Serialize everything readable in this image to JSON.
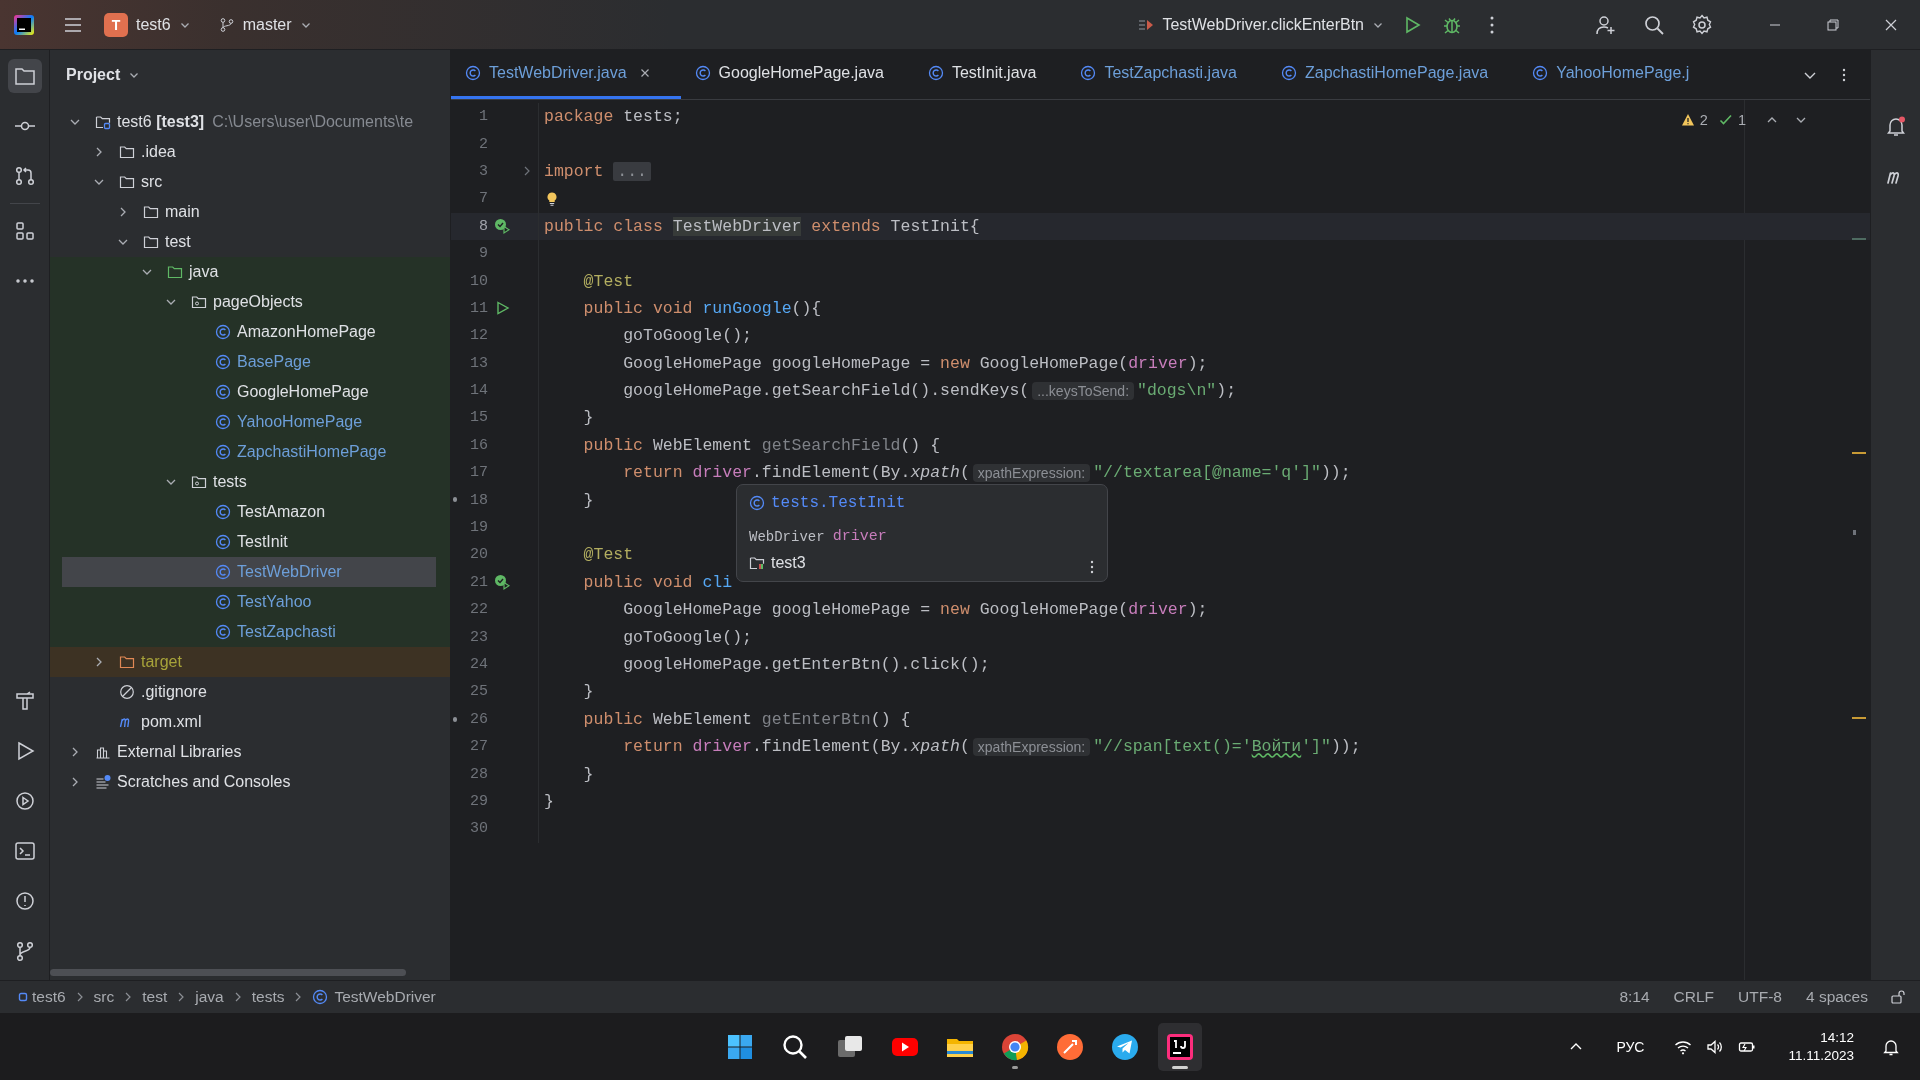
{
  "topbar": {
    "project_badge": "T",
    "project": "test6",
    "branch": "master",
    "run_config": "TestWebDriver.clickEnterBtn"
  },
  "left_toolbar": [
    {
      "kind": "project",
      "selected": true
    },
    {
      "kind": "commit",
      "selected": false
    },
    {
      "kind": "pull-requests",
      "selected": false
    },
    {
      "kind": "structure",
      "selected": false
    },
    {
      "kind": "more",
      "selected": false
    },
    {
      "kind": "build",
      "selected": false
    },
    {
      "kind": "run",
      "selected": false
    },
    {
      "kind": "services",
      "selected": false
    },
    {
      "kind": "terminal",
      "selected": false
    },
    {
      "kind": "problems",
      "selected": false
    },
    {
      "kind": "git",
      "selected": false
    }
  ],
  "tool_window": {
    "title": "Project"
  },
  "project_tree": [
    {
      "kind": "module",
      "label": "test6 **[test3]**",
      "path": "C:\\Users\\user\\Documents\\te",
      "expanded": true,
      "selected": false,
      "children": [
        {
          "kind": "folder",
          "label": ".idea",
          "expanded": false,
          "selected": false
        },
        {
          "kind": "folder",
          "label": "src",
          "expanded": true,
          "selected": false,
          "children": [
            {
              "kind": "folder",
              "label": "main",
              "expanded": false,
              "selected": false
            },
            {
              "kind": "folder",
              "label": "test",
              "expanded": true,
              "selected": false,
              "children": [
                {
                  "kind": "test-root",
                  "label": "java",
                  "expanded": true,
                  "selected": false,
                  "children": [
                    {
                      "kind": "package",
                      "label": "pageObjects",
                      "expanded": true,
                      "selected": false,
                      "children": [
                        {
                          "kind": "class",
                          "label": "AmazonHomePage",
                          "selected": false,
                          "modified": false
                        },
                        {
                          "kind": "class",
                          "label": "BasePage",
                          "selected": false,
                          "modified": true
                        },
                        {
                          "kind": "class",
                          "label": "GoogleHomePage",
                          "selected": false,
                          "modified": false
                        },
                        {
                          "kind": "class",
                          "label": "YahooHomePage",
                          "selected": false,
                          "modified": true
                        },
                        {
                          "kind": "class",
                          "label": "ZapchastiHomePage",
                          "selected": false,
                          "modified": true
                        }
                      ]
                    },
                    {
                      "kind": "package",
                      "label": "tests",
                      "expanded": true,
                      "selected": false,
                      "children": [
                        {
                          "kind": "class",
                          "label": "TestAmazon",
                          "selected": false,
                          "modified": false
                        },
                        {
                          "kind": "class",
                          "label": "TestInit",
                          "selected": false,
                          "modified": false
                        },
                        {
                          "kind": "class",
                          "label": "TestWebDriver",
                          "selected": true,
                          "modified": true
                        },
                        {
                          "kind": "class",
                          "label": "TestYahoo",
                          "selected": false,
                          "modified": true
                        },
                        {
                          "kind": "class",
                          "label": "TestZapchasti",
                          "selected": false,
                          "modified": true
                        }
                      ]
                    }
                  ]
                }
              ]
            }
          ]
        },
        {
          "kind": "excluded-folder",
          "label": "target",
          "expanded": false,
          "selected": false
        },
        {
          "kind": "ignore-file",
          "label": ".gitignore",
          "selected": false
        },
        {
          "kind": "maven",
          "label": "pom.xml",
          "selected": false
        }
      ]
    },
    {
      "kind": "libraries",
      "label": "External Libraries",
      "expanded": false,
      "selected": false
    },
    {
      "kind": "scratches",
      "label": "Scratches and Consoles",
      "expanded": false,
      "selected": false
    }
  ],
  "tabs": [
    {
      "label": "TestWebDriver.java",
      "selected": true,
      "modified": true
    },
    {
      "label": "GoogleHomePage.java",
      "selected": false,
      "modified": false
    },
    {
      "label": "TestInit.java",
      "selected": false,
      "modified": false
    },
    {
      "label": "TestZapchasti.java",
      "selected": false,
      "modified": true
    },
    {
      "label": "ZapchastiHomePage.java",
      "selected": false,
      "modified": true
    },
    {
      "label": "YahooHomePage.j",
      "selected": false,
      "modified": true
    }
  ],
  "editor": {
    "inspections": {
      "warnings": "2",
      "checks": "1"
    },
    "lines": [
      {
        "number": "1",
        "current": false,
        "tokens": [
          {
            "kind": "kw",
            "text": "package"
          },
          {
            "kind": "plain",
            "text": " tests;"
          }
        ]
      },
      {
        "number": "2",
        "current": false
      },
      {
        "number": "3",
        "current": false,
        "gutter": {
          "kind": "fold"
        },
        "tokens": [
          {
            "kind": "kw",
            "text": "import "
          },
          {
            "kind": "fold",
            "text": "..."
          }
        ]
      },
      {
        "number": "7",
        "current": false,
        "gutter": {
          "kind": "bulb"
        }
      },
      {
        "number": "8",
        "current": true,
        "gutter": {
          "kind": "run-passed"
        },
        "tokens": [
          {
            "kind": "kw",
            "text": "public class "
          },
          {
            "kind": "highlight",
            "text": "TestWebDriver"
          },
          {
            "kind": "kw",
            "text": " extends "
          },
          {
            "kind": "plain",
            "text": "TestInit{"
          }
        ]
      },
      {
        "number": "9",
        "current": false
      },
      {
        "number": "10",
        "current": false,
        "tokens": [
          {
            "kind": "annotation",
            "text": "    @Test"
          }
        ]
      },
      {
        "number": "11",
        "current": false,
        "gutter": {
          "kind": "run"
        },
        "tokens": [
          {
            "kind": "kw",
            "text": "    public void "
          },
          {
            "kind": "decl",
            "text": "runGoogle"
          },
          {
            "kind": "plain",
            "text": "(){"
          }
        ]
      },
      {
        "number": "12",
        "current": false,
        "tokens": [
          {
            "kind": "plain",
            "text": "        goToGoogle();"
          }
        ]
      },
      {
        "number": "13",
        "current": false,
        "tokens": [
          {
            "kind": "plain",
            "text": "        GoogleHomePage googleHomePage = "
          },
          {
            "kind": "kw",
            "text": "new "
          },
          {
            "kind": "plain",
            "text": "GoogleHomePage("
          },
          {
            "kind": "field",
            "text": "driver"
          },
          {
            "kind": "plain",
            "text": ");"
          }
        ]
      },
      {
        "number": "14",
        "current": false,
        "tokens": [
          {
            "kind": "plain",
            "text": "        googleHomePage.getSearchField().sendKeys("
          },
          {
            "kind": "hint",
            "text": "...keysToSend:"
          },
          {
            "kind": "string",
            "text": "\"dogs\\n\""
          },
          {
            "kind": "plain",
            "text": ");"
          }
        ]
      },
      {
        "number": "15",
        "current": false,
        "tokens": [
          {
            "kind": "plain",
            "text": "    }"
          }
        ]
      },
      {
        "number": "16",
        "current": false,
        "tokens": [
          {
            "kind": "kw",
            "text": "    public "
          },
          {
            "kind": "plain",
            "text": "WebElement "
          },
          {
            "kind": "muted",
            "text": "getSearchField"
          },
          {
            "kind": "plain",
            "text": "() {"
          }
        ]
      },
      {
        "number": "17",
        "current": false,
        "tokens": [
          {
            "kind": "kw",
            "text": "        return "
          },
          {
            "kind": "field",
            "text": "driver"
          },
          {
            "kind": "plain",
            "text": ".findElement(By."
          },
          {
            "kind": "italic",
            "text": "xpath"
          },
          {
            "kind": "plain",
            "text": "("
          },
          {
            "kind": "hint",
            "text": "xpathExpression:"
          },
          {
            "kind": "string",
            "text": "\"//textarea[@name='q']\""
          },
          {
            "kind": "plain",
            "text": "));"
          }
        ]
      },
      {
        "number": "18",
        "current": false,
        "gutter": {
          "kind": "dot"
        },
        "tokens": [
          {
            "kind": "plain",
            "text": "    }"
          }
        ]
      },
      {
        "number": "19",
        "current": false
      },
      {
        "number": "20",
        "current": false,
        "tokens": [
          {
            "kind": "annotation",
            "text": "    @Test"
          }
        ]
      },
      {
        "number": "21",
        "current": false,
        "gutter": {
          "kind": "run-passed"
        },
        "tokens": [
          {
            "kind": "kw",
            "text": "    public void "
          },
          {
            "kind": "decl",
            "text": "cli"
          }
        ]
      },
      {
        "number": "22",
        "current": false,
        "tokens": [
          {
            "kind": "plain",
            "text": "        GoogleHomePage googleHomePage = "
          },
          {
            "kind": "kw",
            "text": "new "
          },
          {
            "kind": "plain",
            "text": "GoogleHomePage("
          },
          {
            "kind": "field",
            "text": "driver"
          },
          {
            "kind": "plain",
            "text": ");"
          }
        ]
      },
      {
        "number": "23",
        "current": false,
        "tokens": [
          {
            "kind": "plain",
            "text": "        goToGoogle();"
          }
        ]
      },
      {
        "number": "24",
        "current": false,
        "tokens": [
          {
            "kind": "plain",
            "text": "        googleHomePage.getEnterBtn().click();"
          }
        ]
      },
      {
        "number": "25",
        "current": false,
        "tokens": [
          {
            "kind": "plain",
            "text": "    }"
          }
        ]
      },
      {
        "number": "26",
        "current": false,
        "gutter": {
          "kind": "dot"
        },
        "tokens": [
          {
            "kind": "kw",
            "text": "    public "
          },
          {
            "kind": "plain",
            "text": "WebElement "
          },
          {
            "kind": "muted",
            "text": "getEnterBtn"
          },
          {
            "kind": "plain",
            "text": "() {"
          }
        ]
      },
      {
        "number": "27",
        "current": false,
        "tokens": [
          {
            "kind": "kw",
            "text": "        return "
          },
          {
            "kind": "field",
            "text": "driver"
          },
          {
            "kind": "plain",
            "text": ".findElement(By."
          },
          {
            "kind": "italic",
            "text": "xpath"
          },
          {
            "kind": "plain",
            "text": "("
          },
          {
            "kind": "hint",
            "text": "xpathExpression:"
          },
          {
            "kind": "string",
            "text": "\"//span[text()='"
          },
          {
            "kind": "typo",
            "text": "Войти"
          },
          {
            "kind": "string",
            "text": "']\""
          },
          {
            "kind": "plain",
            "text": "));"
          }
        ]
      },
      {
        "number": "28",
        "current": false,
        "tokens": [
          {
            "kind": "plain",
            "text": "    }"
          }
        ]
      },
      {
        "number": "29",
        "current": false,
        "tokens": [
          {
            "kind": "plain",
            "text": "}"
          }
        ]
      },
      {
        "number": "30",
        "current": false
      }
    ],
    "popup": {
      "class_name": "tests.TestInit",
      "field_type": "WebDriver",
      "field_name": "driver",
      "module": "test3"
    }
  },
  "breadcrumbs": [
    "test6",
    "src",
    "test",
    "java",
    "tests",
    "TestWebDriver"
  ],
  "status": {
    "position": "8:14",
    "line_separator": "CRLF",
    "encoding": "UTF-8",
    "indent": "4 spaces"
  },
  "taskbar": {
    "apps": [
      {
        "kind": "start",
        "running": false,
        "selected": false
      },
      {
        "kind": "search",
        "running": false,
        "selected": false
      },
      {
        "kind": "task-view",
        "running": false,
        "selected": false
      },
      {
        "kind": "video",
        "running": false,
        "selected": false
      },
      {
        "kind": "files",
        "running": false,
        "selected": false
      },
      {
        "kind": "browser",
        "running": true,
        "selected": false
      },
      {
        "kind": "api-client",
        "running": false,
        "selected": false
      },
      {
        "kind": "messenger",
        "running": false,
        "selected": false
      },
      {
        "kind": "ide",
        "running": true,
        "selected": true
      }
    ],
    "language": "РУС",
    "time": "14:12",
    "date": "11.11.2023"
  }
}
